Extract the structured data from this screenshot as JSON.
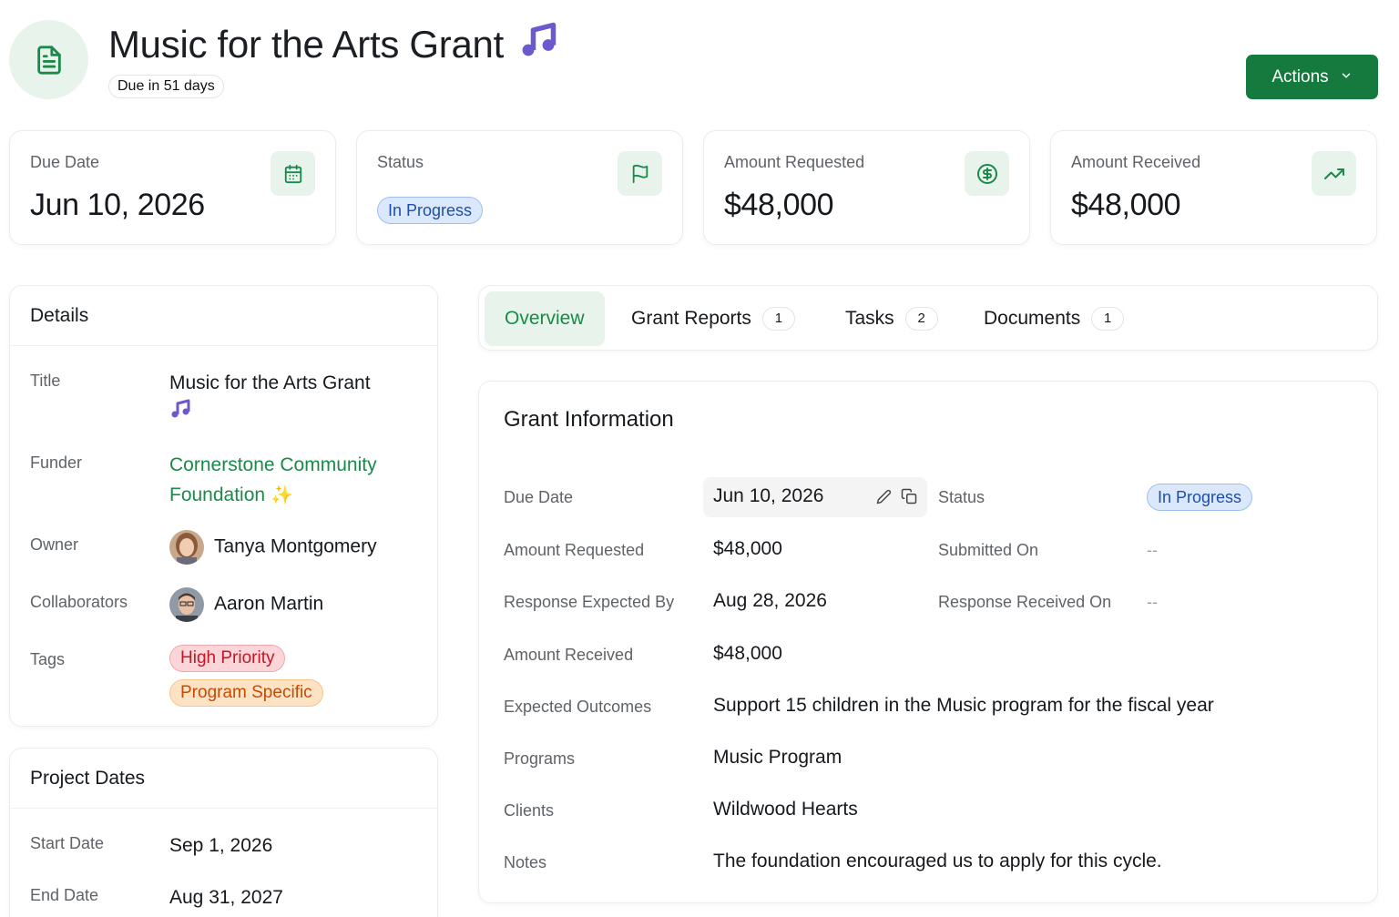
{
  "header": {
    "title": "Music for the Arts Grant",
    "due_badge": "Due in 51 days",
    "actions_label": "Actions"
  },
  "stats": [
    {
      "label": "Due Date",
      "value": "Jun 10, 2026",
      "icon": "calendar-icon"
    },
    {
      "label": "Status",
      "value": "In Progress",
      "icon": "flag-icon"
    },
    {
      "label": "Amount Requested",
      "value": "$48,000",
      "icon": "dollar-circle-icon"
    },
    {
      "label": "Amount Received",
      "value": "$48,000",
      "icon": "trending-up-icon"
    }
  ],
  "details": {
    "heading": "Details",
    "title_label": "Title",
    "title_value": "Music for the Arts Grant",
    "funder_label": "Funder",
    "funder_value": "Cornerstone Community Foundation",
    "owner_label": "Owner",
    "owner_value": "Tanya Montgomery",
    "collaborators_label": "Collaborators",
    "collaborators_value": "Aaron Martin",
    "tags_label": "Tags",
    "tags": [
      "High Priority",
      "Program Specific"
    ]
  },
  "project_dates": {
    "heading": "Project Dates",
    "start_label": "Start Date",
    "start_value": "Sep 1, 2026",
    "end_label": "End Date",
    "end_value": "Aug 31, 2027"
  },
  "tabs": [
    {
      "label": "Overview",
      "count": null,
      "active": true
    },
    {
      "label": "Grant Reports",
      "count": "1"
    },
    {
      "label": "Tasks",
      "count": "2"
    },
    {
      "label": "Documents",
      "count": "1"
    }
  ],
  "grant_info": {
    "heading": "Grant Information",
    "due_date_label": "Due Date",
    "due_date_value": "Jun 10, 2026",
    "status_label": "Status",
    "status_value": "In Progress",
    "amount_requested_label": "Amount Requested",
    "amount_requested_value": "$48,000",
    "submitted_on_label": "Submitted On",
    "submitted_on_value": "--",
    "response_expected_label": "Response Expected By",
    "response_expected_value": "Aug 28, 2026",
    "response_received_label": "Response Received On",
    "response_received_value": "--",
    "amount_received_label": "Amount Received",
    "amount_received_value": "$48,000",
    "expected_outcomes_label": "Expected Outcomes",
    "expected_outcomes_value": "Support 15 children in the Music program for the fiscal year",
    "programs_label": "Programs",
    "programs_value": "Music Program",
    "clients_label": "Clients",
    "clients_value": "Wildwood Hearts",
    "notes_label": "Notes",
    "notes_value": "The foundation encouraged us to apply for this cycle."
  },
  "colors": {
    "brand_green": "#157a3e",
    "link_green": "#1a8a4a",
    "icon_bg": "#e8f3ec",
    "status_blue": "#1d4fa8"
  }
}
